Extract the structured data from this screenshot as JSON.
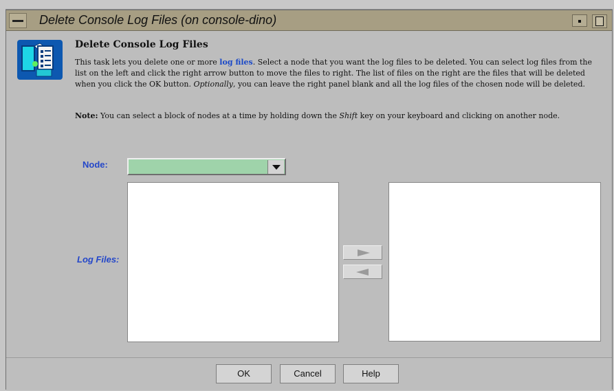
{
  "window": {
    "title": "Delete Console Log Files (on console-dino)"
  },
  "task": {
    "heading": "Delete Console Log Files",
    "description_prefix": "This task lets you delete one or more ",
    "link_text": "log files",
    "description_mid": ". Select a node that you want the log files to be deleted. You can select log files from the list on the left and click the right arrow button to move the files to right. The list of files on the right are the files that will be deleted when you click the OK button. ",
    "optional_word": "Optionally",
    "description_suffix": ", you can leave the right panel blank and all the log files of the chosen node will be deleted.",
    "note_label": "Note:",
    "note_prefix": "  You can select a block of nodes at a time by holding down the ",
    "note_key": "Shift",
    "note_suffix": " key on your keyboard and clicking on another node."
  },
  "form": {
    "node_label": "Node:",
    "node_value": "",
    "log_files_label": "Log Files:",
    "left_list_items": [],
    "right_list_items": []
  },
  "buttons": {
    "ok": "OK",
    "cancel": "Cancel",
    "help": "Help"
  },
  "colors": {
    "link": "#1b49c8",
    "node_field": "#9fd3aa",
    "titlebar": "#a79e83"
  },
  "icons": {
    "task": "log-files-icon",
    "dropdown": "chevron-down-icon",
    "move_right": "arrow-right-icon",
    "move_left": "arrow-left-icon"
  }
}
